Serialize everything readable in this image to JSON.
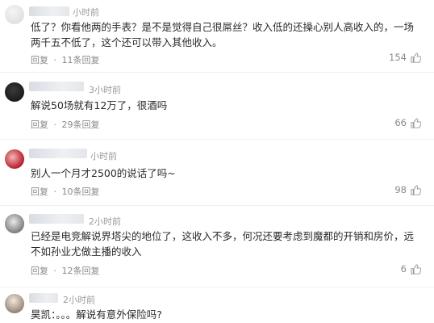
{
  "comments": [
    {
      "time": "小时前",
      "text": "低了？你看他两的手表？是不是觉得自己很屌丝？收入低的还操心别人高收入的，一场两千五不低了，这个还可以带入其他收入。",
      "reply_label": "回复",
      "separator": "·",
      "replies": "11条回复",
      "likes": "154"
    },
    {
      "time": "3小时前",
      "text": "解说50场就有12万了，很酒吗",
      "reply_label": "回复",
      "separator": "·",
      "replies": "29条回复",
      "likes": "66"
    },
    {
      "time": "小时前",
      "text": "别人一个月才2500的说话了吗~",
      "reply_label": "回复",
      "separator": "·",
      "replies": "10条回复",
      "likes": "98"
    },
    {
      "time": "2小时前",
      "text": "已经是电竞解说界塔尖的地位了，这收入不多，何况还要考虑到魔都的开销和房价，远不如孙业尤做主播的收入",
      "reply_label": "回复",
      "separator": "·",
      "replies": "12条回复",
      "likes": "6"
    },
    {
      "time": "2小时前",
      "text": "昊凯：。。。解说有意外保险吗?"
    }
  ],
  "colors": {
    "text": "#2b2b2b",
    "muted": "#9a9a9a",
    "divider": "#f0f0f0"
  }
}
